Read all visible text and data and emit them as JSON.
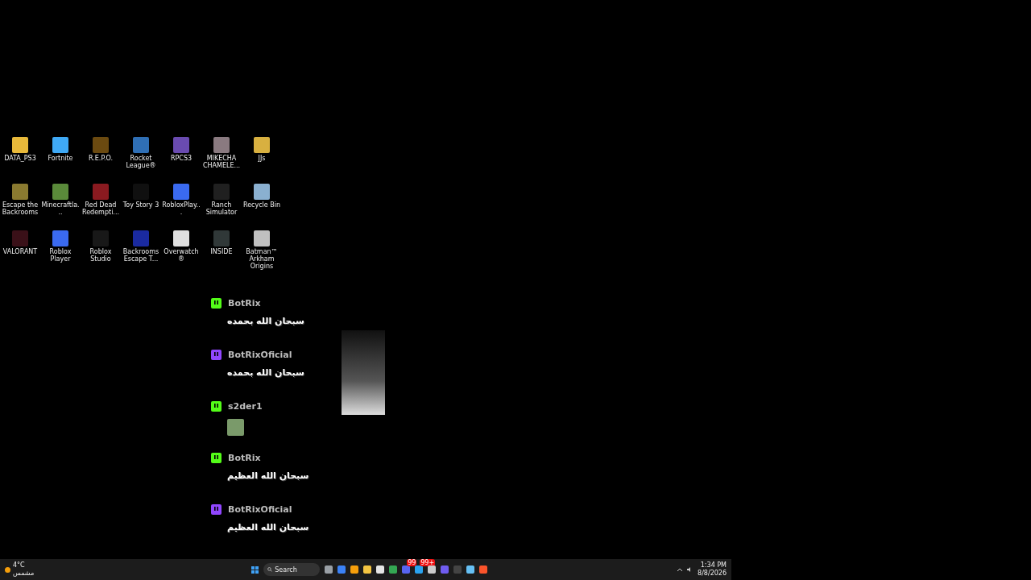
{
  "desktop_icons": [
    {
      "label": "DATA_PS3",
      "color": "#e8b93a"
    },
    {
      "label": "Fortnite",
      "color": "#3fa9f5"
    },
    {
      "label": "R.E.P.O.",
      "color": "#6b4a10"
    },
    {
      "label": "Rocket League®",
      "color": "#2f6fb5"
    },
    {
      "label": "RPCS3",
      "color": "#6a4bb0"
    },
    {
      "label": "MIKECHA CHAMELE...",
      "color": "#8a7a80"
    },
    {
      "label": "JJs",
      "color": "#d8b040"
    },
    {
      "label": "Escape the Backrooms",
      "color": "#8a7a30"
    },
    {
      "label": "Minecraftla...",
      "color": "#5a8a3a"
    },
    {
      "label": "Red Dead Redempti...",
      "color": "#8a1a20"
    },
    {
      "label": "Toy Story 3",
      "color": "#101010"
    },
    {
      "label": "RobloxPlay...",
      "color": "#3a6af0"
    },
    {
      "label": "Ranch Simulator",
      "color": "#202020"
    },
    {
      "label": "Recycle Bin",
      "color": "#8ab0d0"
    },
    {
      "label": "VALORANT",
      "color": "#3a1018"
    },
    {
      "label": "Roblox Player",
      "color": "#3a6af0"
    },
    {
      "label": "Roblox Studio",
      "color": "#181818"
    },
    {
      "label": "Backrooms Escape T...",
      "color": "#1a2aa0"
    },
    {
      "label": "Overwatch®",
      "color": "#e0e0e0"
    },
    {
      "label": "INSIDE",
      "color": "#303838"
    },
    {
      "label": "Batman™ Arkham Origins",
      "color": "#c0c0c0"
    }
  ],
  "chat": [
    {
      "color": "#53fc18",
      "username": "BotRix",
      "kind": "text",
      "message": "سبحان الله بحمده"
    },
    {
      "color": "#9146ff",
      "username": "BotRixOficial",
      "kind": "text",
      "message": "سبحان الله بحمده"
    },
    {
      "color": "#53fc18",
      "username": "s2der1",
      "kind": "emote"
    },
    {
      "color": "#53fc18",
      "username": "BotRix",
      "kind": "text",
      "message": "سبحان الله العظيم"
    },
    {
      "color": "#9146ff",
      "username": "BotRixOficial",
      "kind": "text",
      "message": "سبحان الله العظيم"
    }
  ],
  "taskbar": {
    "weather": {
      "temperature": "4°C",
      "condition": "مشمس"
    },
    "search": {
      "placeholder": "Search"
    },
    "apps": [
      {
        "color": "#9aa0a6"
      },
      {
        "color": "#3b82f6"
      },
      {
        "color": "#f59e0b"
      },
      {
        "color": "#f4c542"
      },
      {
        "color": "#e5e5e5"
      },
      {
        "color": "#34a853"
      },
      {
        "color": "#5865f2",
        "badge": "99"
      },
      {
        "color": "#2aa3ef",
        "badge": "99+"
      },
      {
        "color": "#cccccc"
      },
      {
        "color": "#6f5cf0"
      },
      {
        "color": "#444444"
      },
      {
        "color": "#66c0f4"
      },
      {
        "color": "#fb542b"
      }
    ],
    "time": "1:34 PM",
    "date": "8/8/2026"
  }
}
